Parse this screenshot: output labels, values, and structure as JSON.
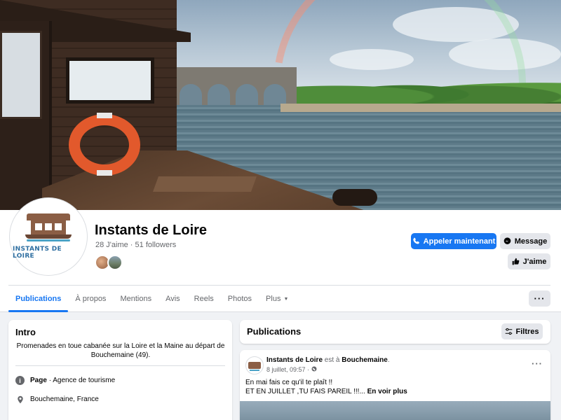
{
  "page": {
    "name": "Instants de Loire",
    "likes": "28 J'aime",
    "separator": "·",
    "followers": "51 followers",
    "logo_text": "INSTANTS DE LOIRE"
  },
  "actions": {
    "call": "Appeler maintenant",
    "message": "Message",
    "like": "J'aime"
  },
  "tabs": [
    {
      "label": "Publications",
      "active": true
    },
    {
      "label": "À propos"
    },
    {
      "label": "Mentions"
    },
    {
      "label": "Avis"
    },
    {
      "label": "Reels"
    },
    {
      "label": "Photos"
    },
    {
      "label": "Plus"
    }
  ],
  "intro": {
    "title": "Intro",
    "description": "Promenades en toue cabanée sur la Loire et la Maine au départ de Bouchemaine (49).",
    "category_label": "Page",
    "category_value": "· Agence de tourisme",
    "location": "Bouchemaine, France"
  },
  "publications": {
    "title": "Publications",
    "filters": "Filtres"
  },
  "post": {
    "author": "Instants de Loire",
    "at_text": "est à",
    "place": "Bouchemaine",
    "place_suffix": ".",
    "date": "8 juillet, 09:57",
    "dot": "·",
    "line1": "En mai fais ce qu'il te plaît !!",
    "line2": "ET EN JUILLET ,TU FAIS PAREIL !!!...",
    "see_more": "En voir plus"
  },
  "icons": {
    "call": "phone-icon",
    "message": "messenger-icon",
    "like": "thumbs-up-icon",
    "more": "more-dots-icon",
    "filters": "sliders-icon",
    "info": "info-icon",
    "location": "location-icon",
    "globe": "globe-icon",
    "caret": "caret-down-icon"
  },
  "colors": {
    "accent": "#1877f2",
    "background": "#f0f2f5",
    "secondary_button": "#e4e6eb"
  }
}
